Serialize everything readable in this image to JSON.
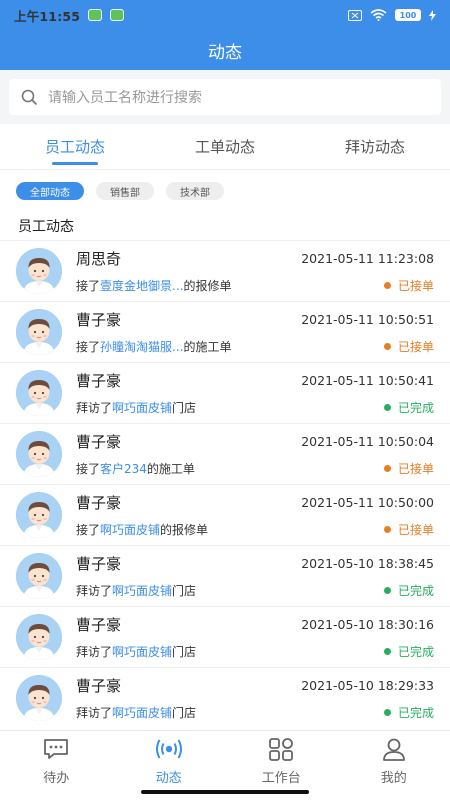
{
  "status_bar": {
    "time": "上午11:55",
    "battery": "100"
  },
  "header": {
    "title": "动态"
  },
  "search": {
    "placeholder": "请输入员工名称进行搜索"
  },
  "tabs": [
    {
      "label": "员工动态",
      "active": true
    },
    {
      "label": "工单动态",
      "active": false
    },
    {
      "label": "拜访动态",
      "active": false
    }
  ],
  "filters": [
    {
      "label": "全部动态",
      "active": true
    },
    {
      "label": "销售部",
      "active": false
    },
    {
      "label": "技术部",
      "active": false
    }
  ],
  "section_title": "员工动态",
  "colors": {
    "accent": "#3d8ee8",
    "received": "#e67e22",
    "completed": "#27ae60"
  },
  "items": [
    {
      "name": "周思奇",
      "time": "2021-05-11 11:23:08",
      "prefix": "接了",
      "link": "壹度金地御景...",
      "suffix": "的报修单",
      "status": "已接单",
      "status_color": "#e67e22"
    },
    {
      "name": "曹子豪",
      "time": "2021-05-11 10:50:51",
      "prefix": "接了",
      "link": "孙瞳淘淘猫服...",
      "suffix": "的施工单",
      "status": "已接单",
      "status_color": "#e67e22"
    },
    {
      "name": "曹子豪",
      "time": "2021-05-11 10:50:41",
      "prefix": "拜访了",
      "link": "啊巧面皮铺",
      "suffix": "门店",
      "status": "已完成",
      "status_color": "#27ae60"
    },
    {
      "name": "曹子豪",
      "time": "2021-05-11 10:50:04",
      "prefix": "接了",
      "link": "客户234",
      "suffix": "的施工单",
      "status": "已接单",
      "status_color": "#e67e22"
    },
    {
      "name": "曹子豪",
      "time": "2021-05-11 10:50:00",
      "prefix": "接了",
      "link": "啊巧面皮铺",
      "suffix": "的报修单",
      "status": "已接单",
      "status_color": "#e67e22"
    },
    {
      "name": "曹子豪",
      "time": "2021-05-10 18:38:45",
      "prefix": "拜访了",
      "link": "啊巧面皮铺",
      "suffix": "门店",
      "status": "已完成",
      "status_color": "#27ae60"
    },
    {
      "name": "曹子豪",
      "time": "2021-05-10 18:30:16",
      "prefix": "拜访了",
      "link": "啊巧面皮铺",
      "suffix": "门店",
      "status": "已完成",
      "status_color": "#27ae60"
    },
    {
      "name": "曹子豪",
      "time": "2021-05-10 18:29:33",
      "prefix": "拜访了",
      "link": "啊巧面皮铺",
      "suffix": "门店",
      "status": "已完成",
      "status_color": "#27ae60"
    }
  ],
  "bottom_nav": [
    {
      "label": "待办",
      "icon": "chat-bubble-icon",
      "active": false
    },
    {
      "label": "动态",
      "icon": "broadcast-icon",
      "active": true
    },
    {
      "label": "工作台",
      "icon": "grid-icon",
      "active": false
    },
    {
      "label": "我的",
      "icon": "user-icon",
      "active": false
    }
  ]
}
